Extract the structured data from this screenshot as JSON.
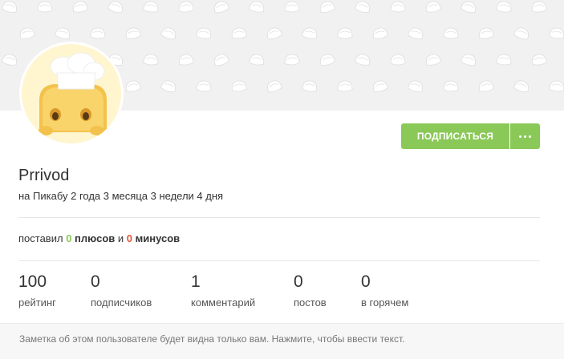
{
  "profile": {
    "username": "Prrivod",
    "member_since": "на Пикабу 2 года 3 месяца 3 недели 4 дня",
    "subscribe_label": "ПОДПИСАТЬСЯ",
    "more_icon": "ellipsis-icon"
  },
  "votes": {
    "prefix": "поставил",
    "plus_count": "0",
    "plus_label": "плюсов",
    "conj": "и",
    "minus_count": "0",
    "minus_label": "минусов"
  },
  "stats": [
    {
      "value": "100",
      "label": "рейтинг"
    },
    {
      "value": "0",
      "label": "подписчиков"
    },
    {
      "value": "1",
      "label": "комментарий"
    },
    {
      "value": "0",
      "label": "постов"
    },
    {
      "value": "0",
      "label": "в горячем"
    }
  ],
  "note": {
    "text": "Заметка об этом пользователе будет видна только вам. Нажмите, чтобы ввести текст."
  },
  "colors": {
    "accent_green": "#8ac858",
    "minus_red": "#e2543c",
    "cover_bg": "#f1f1f1"
  }
}
